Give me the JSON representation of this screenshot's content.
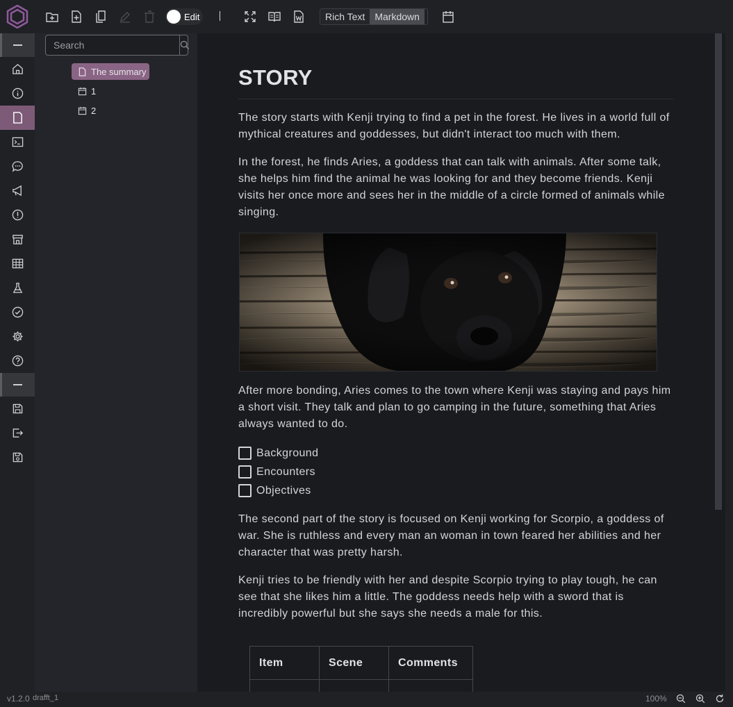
{
  "toolbar": {
    "edit_toggle_label": "Edit",
    "modes": {
      "rich_text": "Rich Text",
      "markdown": "Markdown"
    }
  },
  "tree": {
    "search_placeholder": "Search",
    "nodes": [
      {
        "label": "The summary",
        "icon": "page-icon",
        "selected": true
      },
      {
        "label": "1",
        "icon": "calendar-icon"
      },
      {
        "label": "2",
        "icon": "calendar-icon"
      }
    ]
  },
  "document": {
    "title": "STORY",
    "paragraphs": [
      "The story starts with Kenji trying to find a pet in the forest. He lives in a world full of mythical creatures and goddesses, but didn't interact too much with them.",
      "In the forest, he finds Aries, a goddess that can talk with animals. After some talk, she helps him find the animal he was looking for and they become friends. Kenji visits her once more and sees her in the middle of a circle formed of animals while singing.",
      "After more bonding, Aries comes to the town where Kenji was staying and pays him a short visit. They talk and plan to go camping in the future, something that Aries always wanted to do.",
      "The second part of the story is focused on Kenji working for Scorpio, a goddess of war. She is ruthless and every man an woman in town feared her abilities and her character that was pretty harsh.",
      "Kenji tries to be friendly with her and despite Scorpio trying to play tough, he can see that she likes him a little. The goddess needs help with a sword that is incredibly powerful but she says she needs a male for this."
    ],
    "checklist": [
      "Background",
      "Encounters",
      "Objectives"
    ],
    "table": {
      "headers": [
        "Item",
        "Scene",
        "Comments"
      ]
    }
  },
  "status": {
    "version": "v1.2.0",
    "project": "drafft_1",
    "zoom": "100%"
  },
  "colors": {
    "accent": "#8a6485",
    "rail_active": "#7d5b78",
    "logo": "#8f5a9b"
  }
}
